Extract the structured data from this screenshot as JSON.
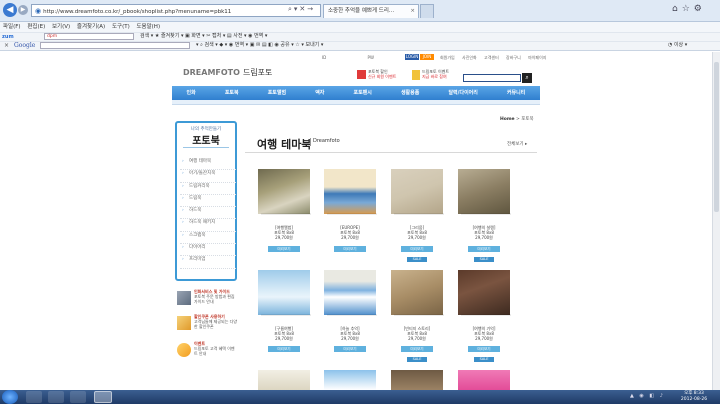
{
  "browser": {
    "url": "http://www.dreamfoto.co.kr/_pbook/shoplist.php?menuname=pbk11",
    "tab_title": "소중한 추억을 예쁘게 드리...",
    "menu": [
      "파일(F)",
      "편집(E)",
      "보기(V)",
      "즐겨찾기(A)",
      "도구(T)",
      "도움말(H)"
    ],
    "zum_brand": "zum",
    "zum_search_value": "dpm",
    "zum_items": "검색 ▾   ★ 즐겨찾기 ▾   ▣ 화면 ▾   ✂ 캡처 ▾   ▤ 사전 ▾   ◉ 번역 ▾",
    "google_brand": "Google",
    "google_items": "▾ ⌕ 검색 ▾  ◆ ▾  ◉ 번역 ▾  ▣ ✉ ▤ ◧ ◉ 공유 ▾  ☆ ▾ 보내기 ▾",
    "google_right": "◔ 이상 ▾",
    "close_x": "×"
  },
  "site": {
    "logo_brand": "DREAMFOTO",
    "logo_korean": "드림포토",
    "top_links": [
      "ID",
      "PW"
    ],
    "login_label": "LOGIN",
    "join_label": "JOIN",
    "right_links": [
      "회원가입",
      "사진인화",
      "고객센터",
      "장바구니",
      "마이페이지"
    ],
    "promo1_line1": "포토북 할인",
    "promo1_line2": "신규 회원 이벤트",
    "promo2_line1": "드림포토 이벤트",
    "promo2_line2": "지금 바로 참여",
    "nav": [
      "인화",
      "포토북",
      "포토앨범",
      "액자",
      "포토팬시",
      "생활용품",
      "달력/다이어리",
      "커뮤니티"
    ],
    "breadcrumb_home": "Home",
    "breadcrumb_sep": ">",
    "breadcrumb_current": "포토북"
  },
  "sidebar": {
    "eyebrow": "나의 추억만들기",
    "title": "포토북",
    "items": [
      "여행 테마북",
      "아기/돌잔치북",
      "드림커리북",
      "드림북",
      "하드북",
      "하드북 패키지",
      "스크랩북",
      "다이어리",
      "프리미엄"
    ],
    "promos": [
      {
        "title": "인화서비스 및 가이드",
        "desc": "포토북 주문 방법과 편집 가이드 안내"
      },
      {
        "title": "할인쿠폰 사용하기",
        "desc": "고객님들께 제공되는 다양한 할인쿠폰"
      },
      {
        "title": "이벤트",
        "desc": "드림포토 고객 혜택 이벤트 안내"
      }
    ]
  },
  "main": {
    "title": "여행 테마북",
    "subtitle": "Dreamfoto",
    "more_link": "전체보기 ▸"
  },
  "products": [
    {
      "name": "[여행앨범]",
      "type": "포토북 8x8",
      "price": "29,700원",
      "btn": "미리보기"
    },
    {
      "name": "[EUROPE]",
      "type": "포토북 8x8",
      "price": "29,700원",
      "btn": "미리보기"
    },
    {
      "name": "[그리움]",
      "type": "포토북 8x8",
      "price": "29,700원",
      "btn": "미리보기",
      "sale": "SALE"
    },
    {
      "name": "[여행의 설렘]",
      "type": "포토북 8x8",
      "price": "29,700원",
      "btn": "미리보기",
      "sale": "SALE"
    },
    {
      "name": "[구름여행]",
      "type": "포토북 8x8",
      "price": "29,700원",
      "btn": "미리보기"
    },
    {
      "name": "[하늘 추억]",
      "type": "포토북 8x8",
      "price": "29,700원",
      "btn": "미리보기"
    },
    {
      "name": "[빈티지 스토리]",
      "type": "포토북 8x8",
      "price": "29,700원",
      "btn": "미리보기",
      "sale": "SALE"
    },
    {
      "name": "[여행의 기억]",
      "type": "포토북 8x8",
      "price": "29,700원",
      "btn": "미리보기",
      "sale": "SALE"
    }
  ],
  "colors": {
    "nav_top": "#5aa5e6",
    "nav_bottom": "#2f7fcf",
    "accent_blue": "#3d9ad6",
    "button_blue": "#5fb1de"
  },
  "taskbar": {
    "time": "오후 8:33",
    "date": "2012-08-26",
    "tray": "▲ ◉ ◧ ♪"
  }
}
